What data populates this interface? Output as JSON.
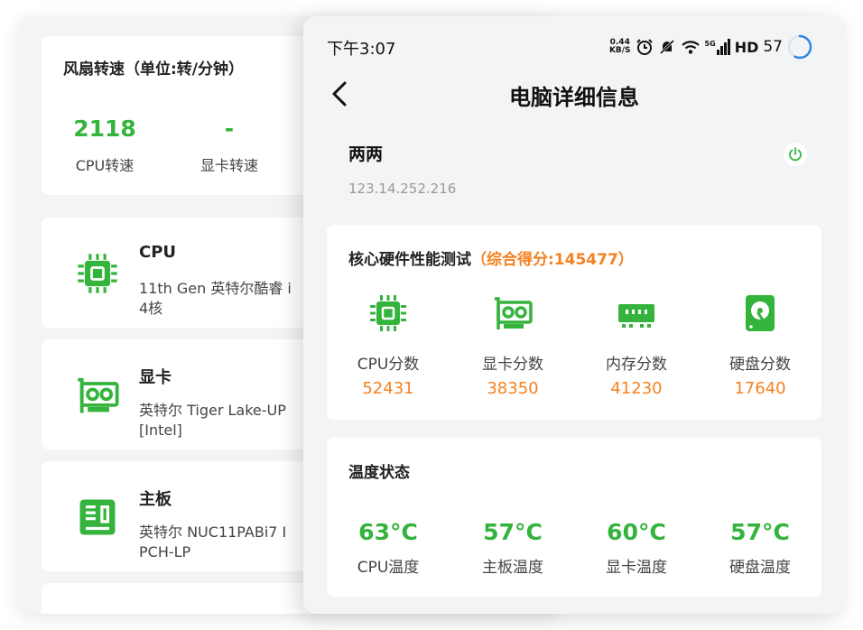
{
  "left_screen": {
    "fan": {
      "title": "风扇转速（单位:转/分钟）",
      "cpu_value": "2118",
      "cpu_label": "CPU转速",
      "gpu_value": "-",
      "gpu_label": "显卡转速"
    },
    "hardware": [
      {
        "title": "CPU",
        "desc": "11th Gen 英特尔酷睿 i\n4核",
        "icon": "cpu-chip-icon"
      },
      {
        "title": "显卡",
        "desc": "英特尔 Tiger Lake-UP\n[Intel]",
        "icon": "graphics-card-icon"
      },
      {
        "title": "主板",
        "desc": "英特尔 NUC11PABi7 I\nPCH-LP",
        "icon": "motherboard-icon"
      }
    ]
  },
  "status_bar": {
    "time": "下午3:07",
    "net_speed_value": "0.44",
    "net_speed_unit": "KB/S",
    "signal": "5G",
    "hd": "HD",
    "battery": "57"
  },
  "header": {
    "title": "电脑详细信息"
  },
  "device": {
    "name": "两两",
    "ip": "123.14.252.216"
  },
  "perf": {
    "title": "核心硬件性能测试",
    "total": "（综合得分:145477）",
    "items": [
      {
        "label": "CPU分数",
        "score": "52431",
        "icon": "cpu-chip-icon"
      },
      {
        "label": "显卡分数",
        "score": "38350",
        "icon": "graphics-card-icon"
      },
      {
        "label": "内存分数",
        "score": "41230",
        "icon": "memory-icon"
      },
      {
        "label": "硬盘分数",
        "score": "17640",
        "icon": "hard-disk-icon"
      }
    ]
  },
  "temperature": {
    "title": "温度状态",
    "items": [
      {
        "value": "63°C",
        "label": "CPU温度"
      },
      {
        "value": "57°C",
        "label": "主板温度"
      },
      {
        "value": "60°C",
        "label": "显卡温度"
      },
      {
        "value": "57°C",
        "label": "硬盘温度"
      }
    ]
  },
  "colors": {
    "accent_green": "#34b43c",
    "accent_orange": "#f58220",
    "background": "#f3f4f6"
  }
}
